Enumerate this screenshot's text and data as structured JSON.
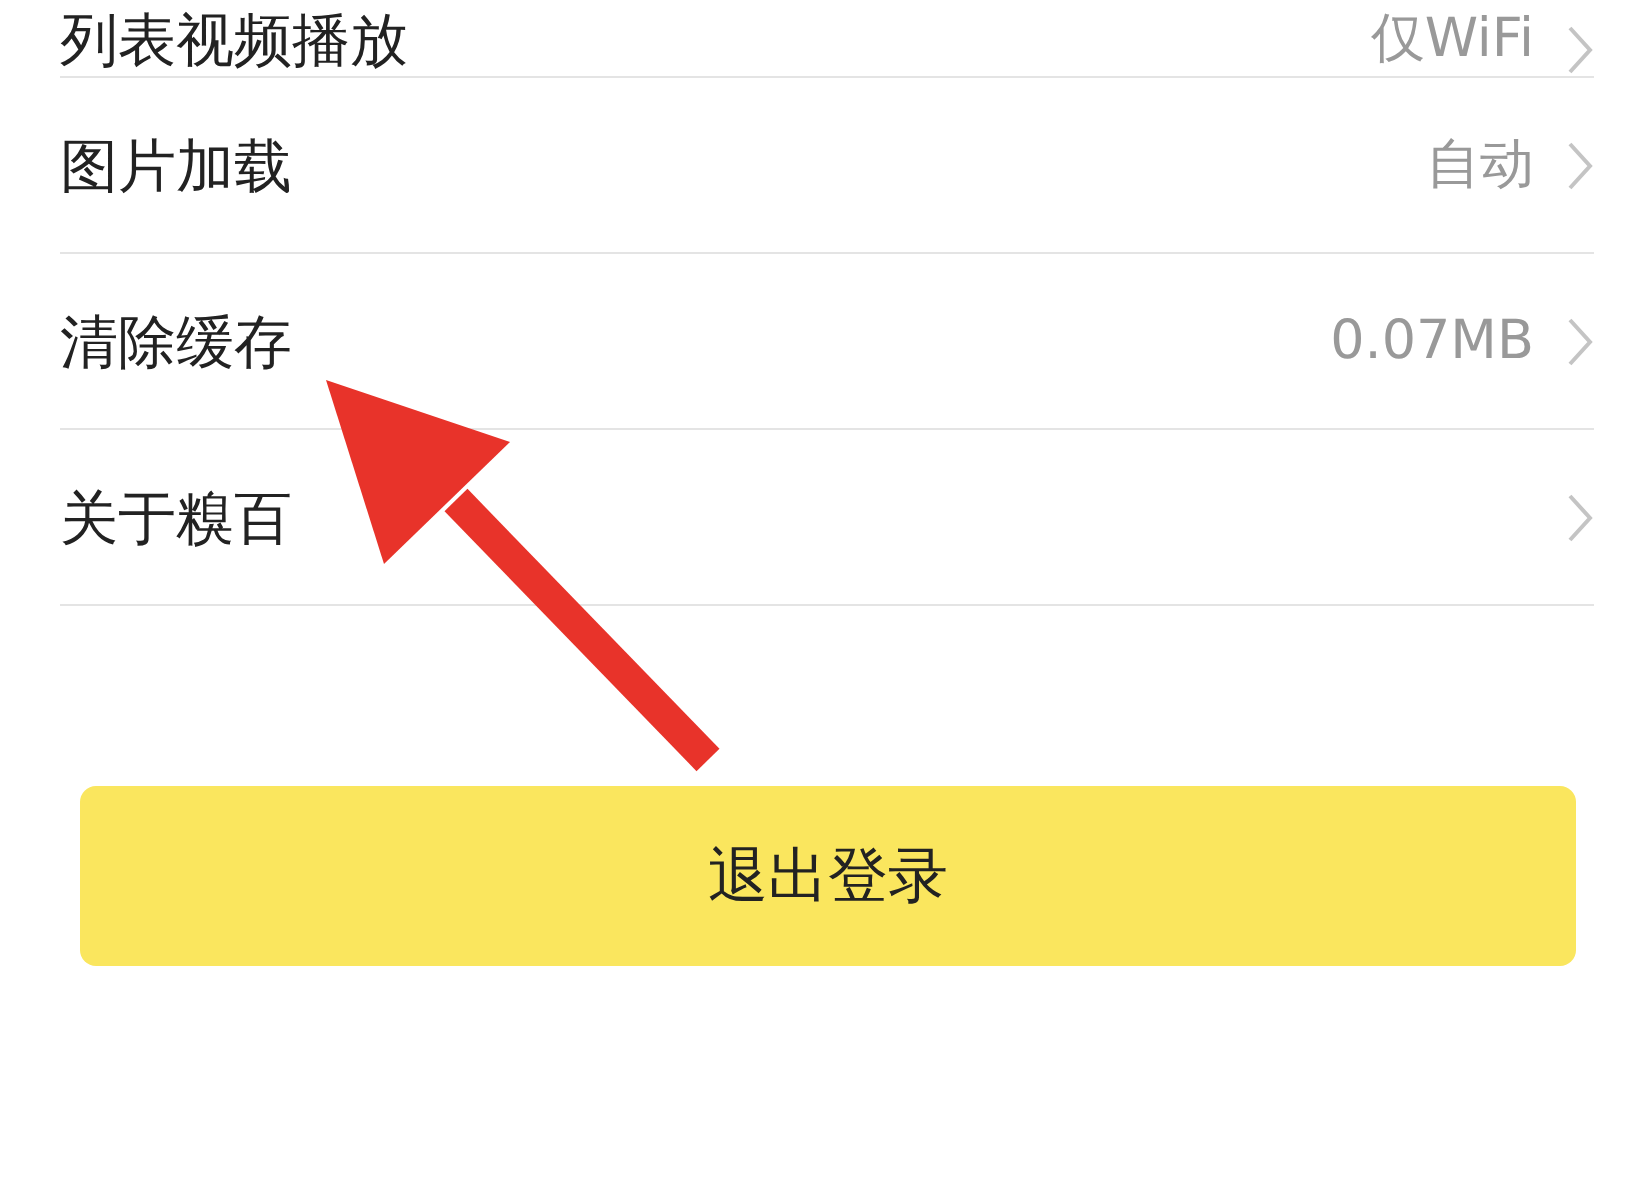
{
  "settings": [
    {
      "label": "列表视频播放",
      "value": "仅WiFi"
    },
    {
      "label": "图片加载",
      "value": "自动"
    },
    {
      "label": "清除缓存",
      "value": "0.07MB"
    },
    {
      "label": "关于糗百"
    }
  ],
  "logout_button": "退出登录"
}
